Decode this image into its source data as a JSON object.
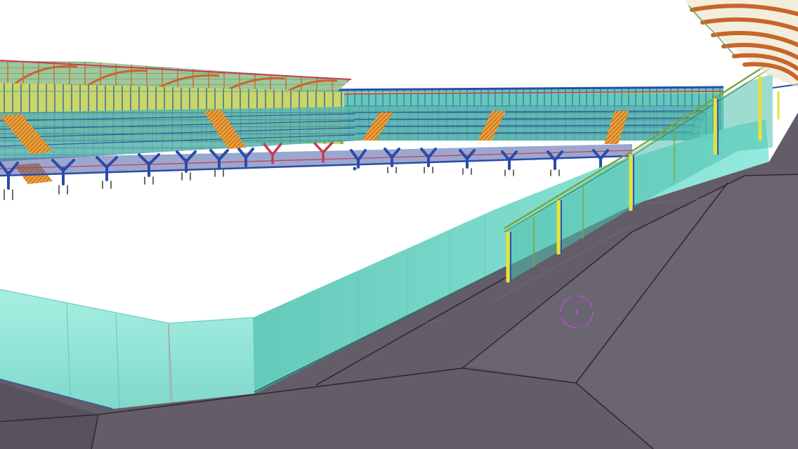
{
  "viewport": {
    "background": "#ffffff",
    "view_type": "3D model viewport"
  },
  "colors": {
    "deck": "#625d68",
    "deck_edge": "#3e3a44",
    "glass": "#8fe3d6",
    "glass_dark": "#6fc9bd",
    "steel_blue": "#2c4ba8",
    "steel_red": "#c83a52",
    "steel_yellow": "#e4d83a",
    "stair_orange": "#e08a2a",
    "roof_wood": "#c8652a",
    "roof_green": "#6aa56a",
    "handrail_green": "#7da43a",
    "post_yellow": "#e7e23a",
    "cursor": "#b054c8"
  },
  "icons": {
    "cursor": "orbit-pivot-icon"
  }
}
